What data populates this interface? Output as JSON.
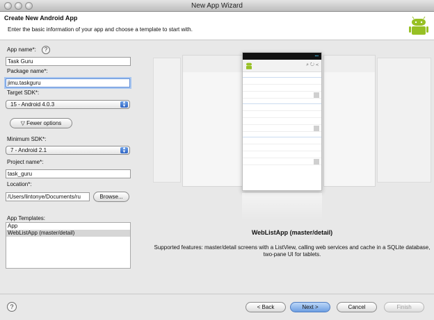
{
  "window": {
    "title": "New App Wizard"
  },
  "header": {
    "title": "Create New Android App",
    "description": "Enter the basic information of your app and choose a template to start with."
  },
  "form": {
    "app_name_label": "App name*:",
    "app_name_value": "Task Guru",
    "package_name_label": "Package name*:",
    "package_name_value": "jimu.taskguru",
    "target_sdk_label": "Target SDK*:",
    "target_sdk_value": "15 - Android 4.0.3",
    "fewer_options_label": "Fewer options",
    "min_sdk_label": "Minimum SDK*:",
    "min_sdk_value": "7 - Android 2.1",
    "project_name_label": "Project name*:",
    "project_name_value": "task_guru",
    "location_label": "Location*:",
    "location_value": "/Users/lintonye/Documents/ru",
    "browse_label": "Browse..."
  },
  "templates": {
    "label": "App Templates:",
    "items": [
      "App",
      "WebListApp (master/detail)"
    ],
    "selected_index": 1
  },
  "preview": {
    "template_title": "WebListApp (master/detail)",
    "description": "Supported features: master/detail screens with a ListView, calling web services and cache in a SQLite database, two-pane UI for tablets."
  },
  "footer": {
    "back_label": "< Back",
    "next_label": "Next >",
    "cancel_label": "Cancel",
    "finish_label": "Finish"
  },
  "colors": {
    "focus_ring": "#a8c6f0",
    "default_button": "#6e9fe2",
    "android_green": "#97c024"
  }
}
